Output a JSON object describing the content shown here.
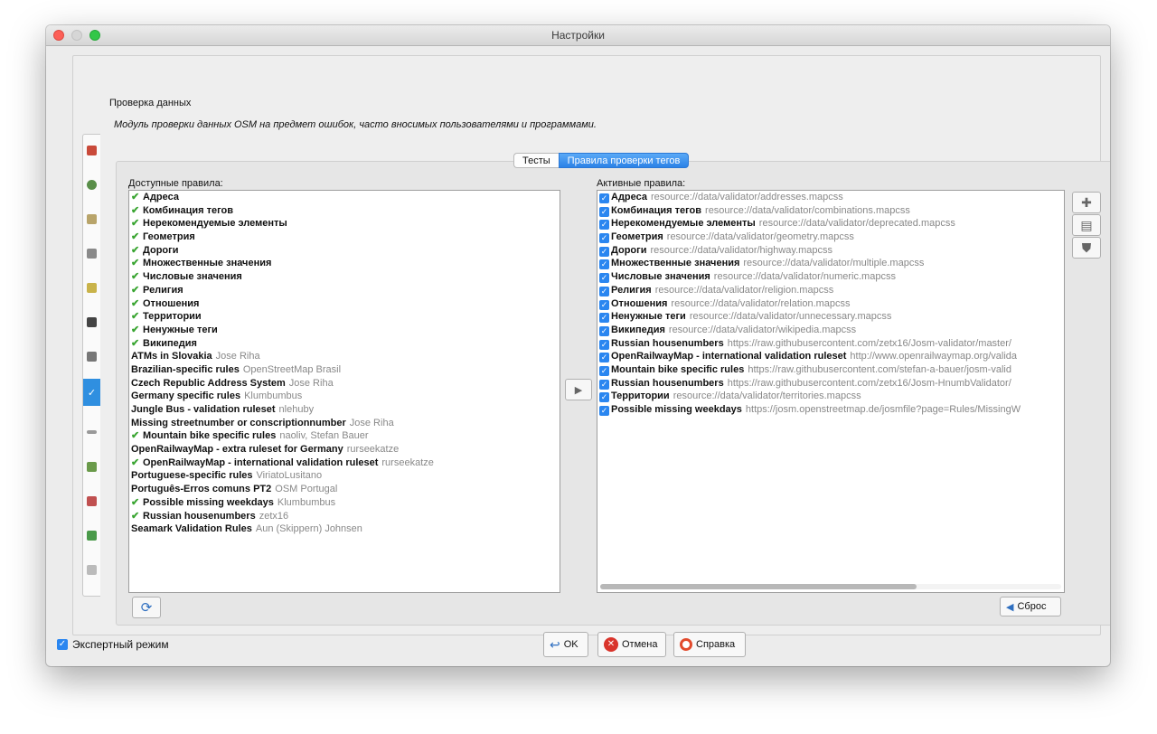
{
  "window": {
    "title": "Настройки"
  },
  "section": {
    "title": "Проверка данных",
    "description": "Модуль проверки данных OSM на предмет ошибок, часто вносимых пользователями и программами."
  },
  "tabs": [
    {
      "label": "Тесты",
      "active": false
    },
    {
      "label": "Правила проверки тегов",
      "active": true
    }
  ],
  "available": {
    "label": "Доступные правила:",
    "items": [
      {
        "name": "Адреса",
        "author": "",
        "checked": true
      },
      {
        "name": "Комбинация тегов",
        "author": "",
        "checked": true
      },
      {
        "name": "Нерекомендуемые элементы",
        "author": "",
        "checked": true
      },
      {
        "name": "Геометрия",
        "author": "",
        "checked": true
      },
      {
        "name": "Дороги",
        "author": "",
        "checked": true
      },
      {
        "name": "Множественные значения",
        "author": "",
        "checked": true
      },
      {
        "name": "Числовые значения",
        "author": "",
        "checked": true
      },
      {
        "name": "Религия",
        "author": "",
        "checked": true
      },
      {
        "name": "Отношения",
        "author": "",
        "checked": true
      },
      {
        "name": "Территории",
        "author": "",
        "checked": true
      },
      {
        "name": "Ненужные теги",
        "author": "",
        "checked": true
      },
      {
        "name": "Википедия",
        "author": "",
        "checked": true
      },
      {
        "name": "ATMs in Slovakia",
        "author": "Jose Riha",
        "checked": false
      },
      {
        "name": "Brazilian-specific rules",
        "author": "OpenStreetMap Brasil",
        "checked": false
      },
      {
        "name": "Czech Republic Address System",
        "author": "Jose Riha",
        "checked": false
      },
      {
        "name": "Germany specific rules",
        "author": "Klumbumbus",
        "checked": false
      },
      {
        "name": "Jungle Bus - validation ruleset",
        "author": "nlehuby",
        "checked": false
      },
      {
        "name": "Missing streetnumber or conscriptionnumber",
        "author": "Jose Riha",
        "checked": false
      },
      {
        "name": "Mountain bike specific rules",
        "author": "naoliv, Stefan Bauer",
        "checked": true
      },
      {
        "name": "OpenRailwayMap - extra ruleset for Germany",
        "author": "rurseekatze",
        "checked": false
      },
      {
        "name": "OpenRailwayMap - international validation ruleset",
        "author": "rurseekatze",
        "checked": true
      },
      {
        "name": "Portuguese-specific rules",
        "author": "ViriatoLusitano",
        "checked": false
      },
      {
        "name": "Português-Erros comuns PT2",
        "author": "OSM Portugal",
        "checked": false
      },
      {
        "name": "Possible missing weekdays",
        "author": "Klumbumbus",
        "checked": true
      },
      {
        "name": "Russian housenumbers",
        "author": "zetx16",
        "checked": true
      },
      {
        "name": "Seamark Validation Rules",
        "author": "Aun (Skippern) Johnsen",
        "checked": false
      }
    ]
  },
  "active": {
    "label": "Активные правила:",
    "items": [
      {
        "name": "Адреса",
        "source": "resource://data/validator/addresses.mapcss"
      },
      {
        "name": "Комбинация тегов",
        "source": "resource://data/validator/combinations.mapcss"
      },
      {
        "name": "Нерекомендуемые элементы",
        "source": "resource://data/validator/deprecated.mapcss"
      },
      {
        "name": "Геометрия",
        "source": "resource://data/validator/geometry.mapcss"
      },
      {
        "name": "Дороги",
        "source": "resource://data/validator/highway.mapcss"
      },
      {
        "name": "Множественные значения",
        "source": "resource://data/validator/multiple.mapcss"
      },
      {
        "name": "Числовые значения",
        "source": "resource://data/validator/numeric.mapcss"
      },
      {
        "name": "Религия",
        "source": "resource://data/validator/religion.mapcss"
      },
      {
        "name": "Отношения",
        "source": "resource://data/validator/relation.mapcss"
      },
      {
        "name": "Ненужные теги",
        "source": "resource://data/validator/unnecessary.mapcss"
      },
      {
        "name": "Википедия",
        "source": "resource://data/validator/wikipedia.mapcss"
      },
      {
        "name": "Russian housenumbers",
        "source": "https://raw.githubusercontent.com/zetx16/Josm-validator/master/"
      },
      {
        "name": "OpenRailwayMap - international validation ruleset",
        "source": "http://www.openrailwaymap.org/valida"
      },
      {
        "name": "Mountain bike specific rules",
        "source": "https://raw.githubusercontent.com/stefan-a-bauer/josm-valid"
      },
      {
        "name": "Russian housenumbers",
        "source": "https://raw.githubusercontent.com/zetx16/Josm-HnumbValidator/"
      },
      {
        "name": "Территории",
        "source": "resource://data/validator/territories.mapcss"
      },
      {
        "name": "Possible missing weekdays",
        "source": "https://josm.openstreetmap.de/josmfile?page=Rules/MissingW"
      }
    ]
  },
  "buttons": {
    "reset": "Сброс",
    "ok": "OK",
    "cancel": "Отмена",
    "help": "Справка"
  },
  "expert_mode": {
    "label": "Экспертный режим",
    "checked": true
  },
  "colors": {
    "accent": "#2b82e6",
    "check_green": "#3aa532"
  }
}
